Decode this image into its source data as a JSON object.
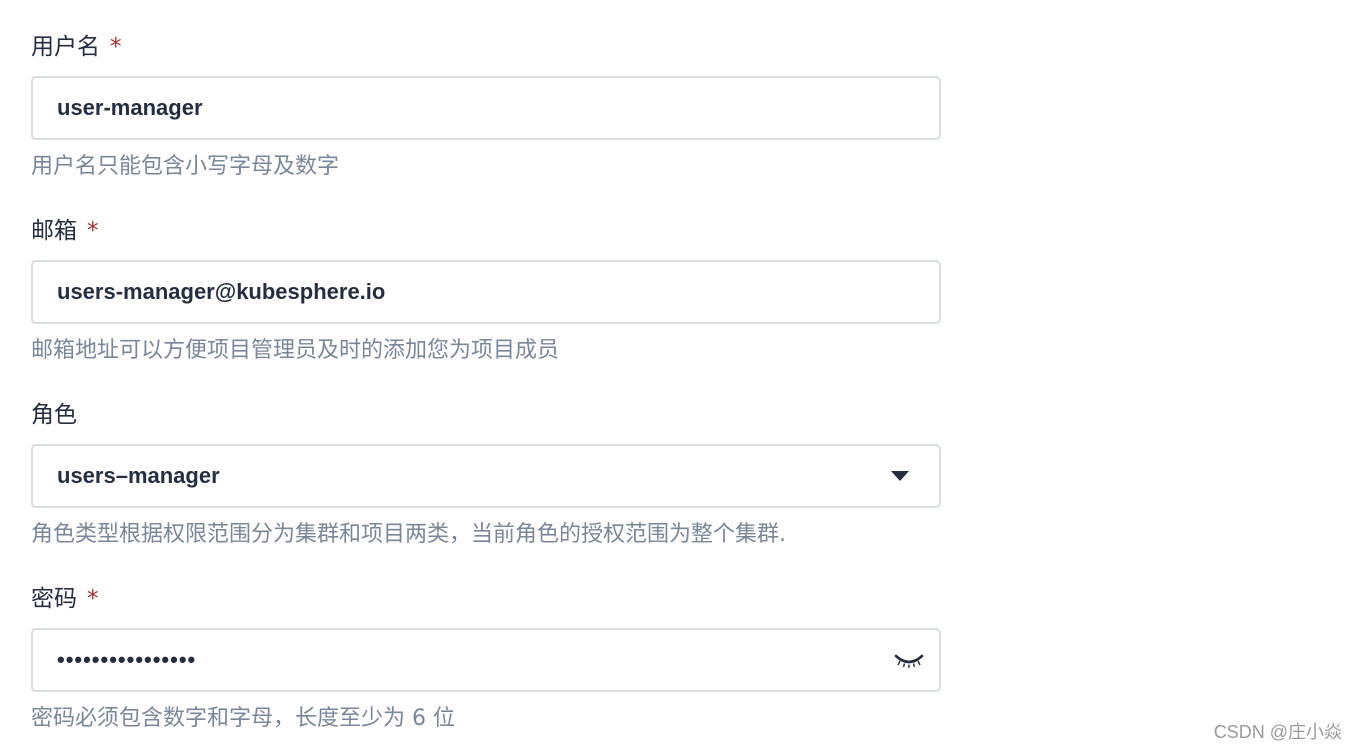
{
  "username": {
    "label": "用户名",
    "required_mark": "*",
    "value": "user-manager",
    "hint": "用户名只能包含小写字母及数字"
  },
  "email": {
    "label": "邮箱",
    "required_mark": "*",
    "value": "users-manager@kubesphere.io",
    "hint": "邮箱地址可以方便项目管理员及时的添加您为项目成员"
  },
  "role": {
    "label": "角色",
    "selected": "users–manager",
    "dropdown_icon": "caret-down-icon",
    "hint": "角色类型根据权限范围分为集群和项目两类，当前角色的授权范围为整个集群."
  },
  "password": {
    "label": "密码",
    "required_mark": "*",
    "masked_value": "••••••••••••••••",
    "toggle_icon": "eye-closed-icon",
    "hint": "密码必须包含数字和字母，长度至少为 6 位"
  },
  "watermark": "CSDN @庄小焱",
  "colors": {
    "text": "#242e42",
    "hint": "#79879c",
    "required": "#ab2f29",
    "border": "#d8dee5"
  }
}
